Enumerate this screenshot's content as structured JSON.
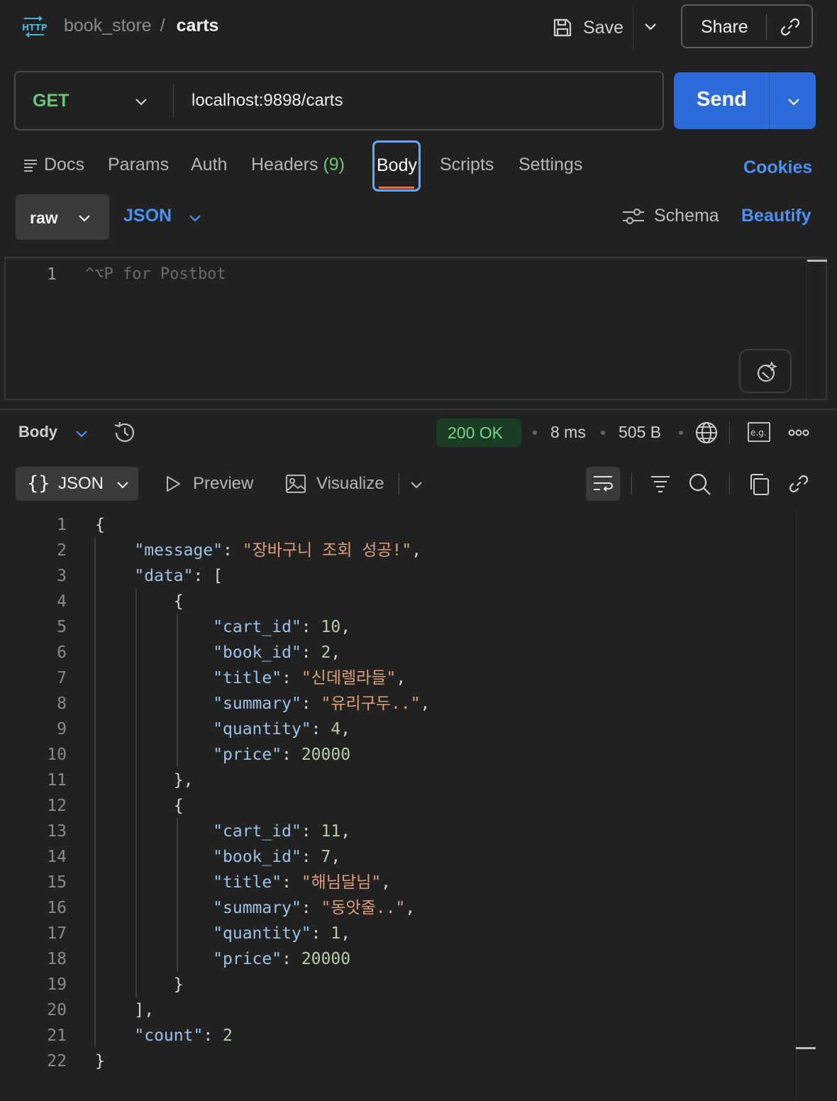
{
  "header": {
    "collection": "book_store",
    "separator": "/",
    "request_name": "carts",
    "save_label": "Save",
    "share_label": "Share"
  },
  "request": {
    "method": "GET",
    "url": "localhost:9898/carts",
    "send_label": "Send",
    "method_color": "#6cc57a",
    "send_color": "#2c6bd8"
  },
  "tabs": {
    "docs": "Docs",
    "params": "Params",
    "auth": "Auth",
    "headers": "Headers",
    "headers_count": "(9)",
    "body": "Body",
    "scripts": "Scripts",
    "settings": "Settings",
    "cookies": "Cookies",
    "active": "Body"
  },
  "body_options": {
    "mode": "raw",
    "language": "JSON",
    "schema": "Schema",
    "beautify": "Beautify"
  },
  "request_editor": {
    "line_number": "1",
    "placeholder": "^⌥P for Postbot"
  },
  "response": {
    "section": "Body",
    "status": "200 OK",
    "time": "8 ms",
    "size": "505 B",
    "status_color": "#7bd389",
    "view": {
      "format": "JSON",
      "format_icon": "{}",
      "preview": "Preview",
      "visualize": "Visualize"
    },
    "lines": [
      "{",
      "    \"message\": \"장바구니 조회 성공!\",",
      "    \"data\": [",
      "        {",
      "            \"cart_id\": 10,",
      "            \"book_id\": 2,",
      "            \"title\": \"신데렐라들\",",
      "            \"summary\": \"유리구두..\",",
      "            \"quantity\": 4,",
      "            \"price\": 20000",
      "        },",
      "        {",
      "            \"cart_id\": 11,",
      "            \"book_id\": 7,",
      "            \"title\": \"해님달님\",",
      "            \"summary\": \"동앗줄..\",",
      "            \"quantity\": 1,",
      "            \"price\": 20000",
      "        }",
      "    ],",
      "    \"count\": 2",
      "}"
    ]
  },
  "icons": {
    "http": "http-icon",
    "save": "save-icon",
    "link": "link-icon",
    "docs": "docs-icon",
    "schema": "schema-sliders-icon",
    "postbot": "postbot-icon",
    "history": "history-icon",
    "globe": "globe-icon",
    "example": "eg-icon",
    "more": "more-icon",
    "preview": "play-icon",
    "visualize": "image-icon",
    "wrap": "wrap-lines-icon",
    "filter": "filter-icon",
    "search": "search-icon",
    "copy": "copy-icon"
  }
}
